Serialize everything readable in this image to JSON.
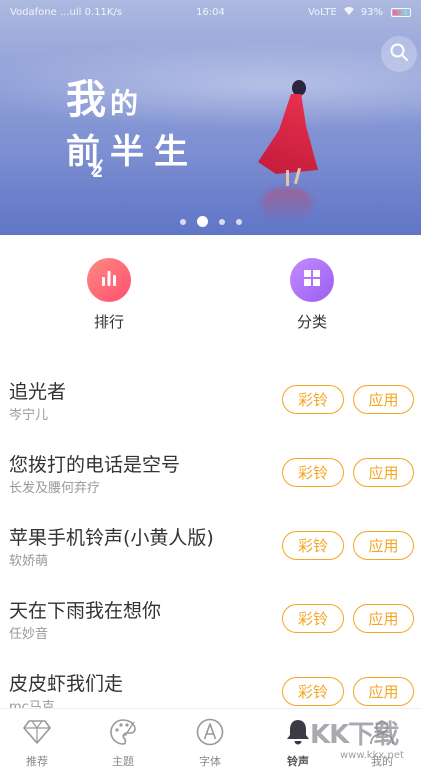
{
  "status_bar": {
    "left_text": "Vodafone ...ull 0.11K/s",
    "time": "16:04",
    "right_text": "VoLTE",
    "battery": "93%"
  },
  "banner": {
    "title_line1_big": "我",
    "title_line1_small": "的",
    "title_line2": "前半生",
    "title_sub": "2",
    "carousel_active_index": 1,
    "carousel_count": 4
  },
  "shortcuts": [
    {
      "label": "排行",
      "icon": "bar-chart-icon"
    },
    {
      "label": "分类",
      "icon": "grid-icon"
    }
  ],
  "songs": [
    {
      "title": "追光者",
      "artist": "岑宁儿",
      "ring_label": "彩铃",
      "apply_label": "应用"
    },
    {
      "title": "您拨打的电话是空号",
      "artist": "长发及腰何弃疗",
      "ring_label": "彩铃",
      "apply_label": "应用"
    },
    {
      "title": "苹果手机铃声(小黄人版)",
      "artist": "软娇萌",
      "ring_label": "彩铃",
      "apply_label": "应用"
    },
    {
      "title": "天在下雨我在想你",
      "artist": "任妙音",
      "ring_label": "彩铃",
      "apply_label": "应用"
    },
    {
      "title": "皮皮虾我们走",
      "artist": "mc马克",
      "ring_label": "彩铃",
      "apply_label": "应用"
    }
  ],
  "tabs": [
    {
      "label": "推荐",
      "icon": "diamond-icon",
      "active": false
    },
    {
      "label": "主题",
      "icon": "palette-icon",
      "active": false
    },
    {
      "label": "字体",
      "icon": "font-icon",
      "active": false
    },
    {
      "label": "铃声",
      "icon": "bell-icon",
      "active": true
    },
    {
      "label": "我的",
      "icon": "user-icon",
      "active": false
    }
  ],
  "watermark": {
    "text": "KK下载",
    "url": "www.kkx.net"
  },
  "colors": {
    "accent_orange": "#f5a623",
    "rank_gradient": "#ff4f6f",
    "category_gradient": "#9b5ef0"
  }
}
